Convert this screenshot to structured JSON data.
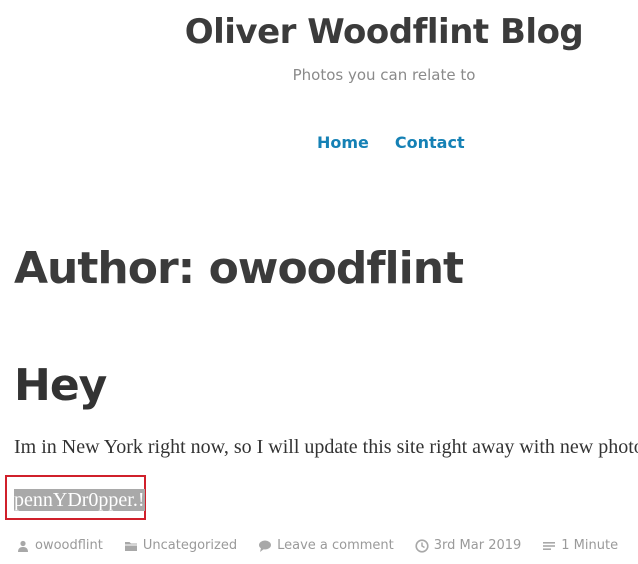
{
  "site": {
    "title": "Oliver Woodflint Blog",
    "description": "Photos you can relate to"
  },
  "nav": {
    "items": [
      {
        "label": "Home"
      },
      {
        "label": "Contact"
      }
    ]
  },
  "archive": {
    "title": "Author: owoodflint"
  },
  "post": {
    "title": "Hey",
    "body": "Im in New York right now, so I will update this site right away with new photos!",
    "selected_text": "pennYDr0pper.!",
    "meta": {
      "author": "owoodflint",
      "category": "Uncategorized",
      "comment_link": "Leave a comment",
      "date": "3rd Mar 2019",
      "read_time": "1 Minute"
    }
  },
  "icons": {
    "author": "user-icon",
    "category": "folder-icon",
    "comment": "comment-icon",
    "date": "clock-icon",
    "read_time": "list-icon"
  },
  "colors": {
    "link": "#1581b5",
    "highlight_border": "#d0202b",
    "selection_bg": "#a9a9a9"
  }
}
